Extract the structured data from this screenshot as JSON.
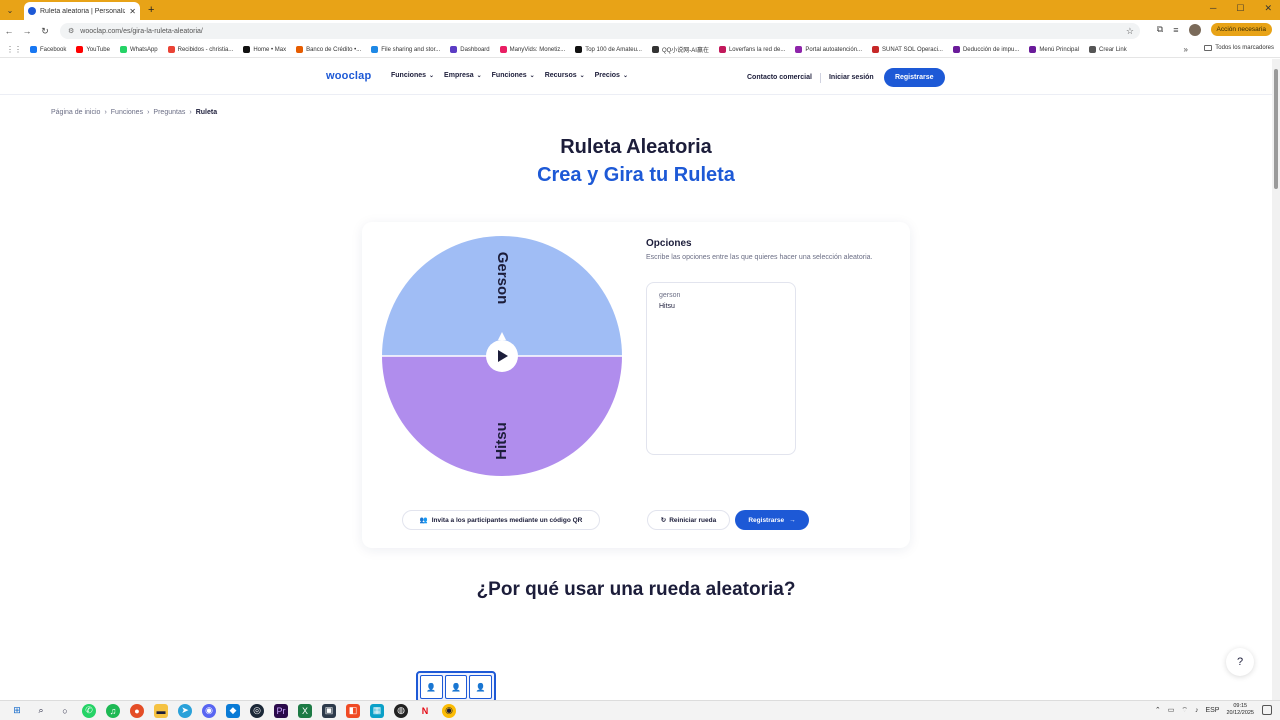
{
  "browser": {
    "tab_title": "Ruleta aleatoria | Personaliza y ...",
    "url": "wooclap.com/es/gira-la-ruleta-aleatoria/",
    "action_pill": "Acción necesaria",
    "bookmarks": [
      {
        "label": "Facebook",
        "color": "#1877f2"
      },
      {
        "label": "YouTube",
        "color": "#ff0000"
      },
      {
        "label": "WhatsApp",
        "color": "#25d366"
      },
      {
        "label": "Recibidos - christia...",
        "color": "#ea4335"
      },
      {
        "label": "Home • Max",
        "color": "#111111"
      },
      {
        "label": "Banco de Crédito •...",
        "color": "#e65c00"
      },
      {
        "label": "File sharing and stor...",
        "color": "#1e88e5"
      },
      {
        "label": "Dashboard",
        "color": "#5b3cc4"
      },
      {
        "label": "ManyVids: Monetiz...",
        "color": "#e91e63"
      },
      {
        "label": "Top 100 de Amateu...",
        "color": "#111111"
      },
      {
        "label": "QQ小说网-AI赢在",
        "color": "#333333"
      },
      {
        "label": "Loverfans la red de...",
        "color": "#c2185b"
      },
      {
        "label": "Portal autoatención...",
        "color": "#8e24aa"
      },
      {
        "label": "SUNAT SOL Operaci...",
        "color": "#c62828"
      },
      {
        "label": "Deducción de impu...",
        "color": "#6a1b9a"
      },
      {
        "label": "Menú Principal",
        "color": "#6a1b9a"
      },
      {
        "label": "Crear Link",
        "color": "#555555"
      }
    ],
    "all_bookmarks": "Todos los marcadores"
  },
  "site": {
    "logo": "wooclap",
    "nav": [
      {
        "label": "Funciones"
      },
      {
        "label": "Empresa"
      },
      {
        "label": "Funciones"
      },
      {
        "label": "Recursos"
      },
      {
        "label": "Precios"
      }
    ],
    "contact": "Contacto comercial",
    "login": "Iniciar sesión",
    "register": "Registrarse",
    "breadcrumb": [
      "Página de inicio",
      "Funciones",
      "Preguntas",
      "Ruleta"
    ],
    "title": "Ruleta Aleatoria",
    "subtitle": "Crea y Gira tu Ruleta",
    "wheel": {
      "segments": [
        {
          "label": "Gerson",
          "color": "#a0bdf5"
        },
        {
          "label": "Hitsu",
          "color": "#b08ded"
        }
      ]
    },
    "options": {
      "title": "Opciones",
      "description": "Escribe las opciones entre las que quieres hacer una selección aleatoria.",
      "lines": [
        "gerson",
        "Hitsu"
      ]
    },
    "qr_button": "Invita a los participantes mediante un código QR",
    "reset_button": "Reiniciar rueda",
    "register_button": "Registrarse",
    "section_title": "¿Por qué usar una rueda aleatoria?",
    "help": "?"
  },
  "taskbar": {
    "lang": "ESP",
    "time": "09:15",
    "date": "20/12/2025"
  },
  "colors": {
    "brand": "#1d59d6",
    "chrome": "#e8a317",
    "navy": "#1c1d3a"
  }
}
